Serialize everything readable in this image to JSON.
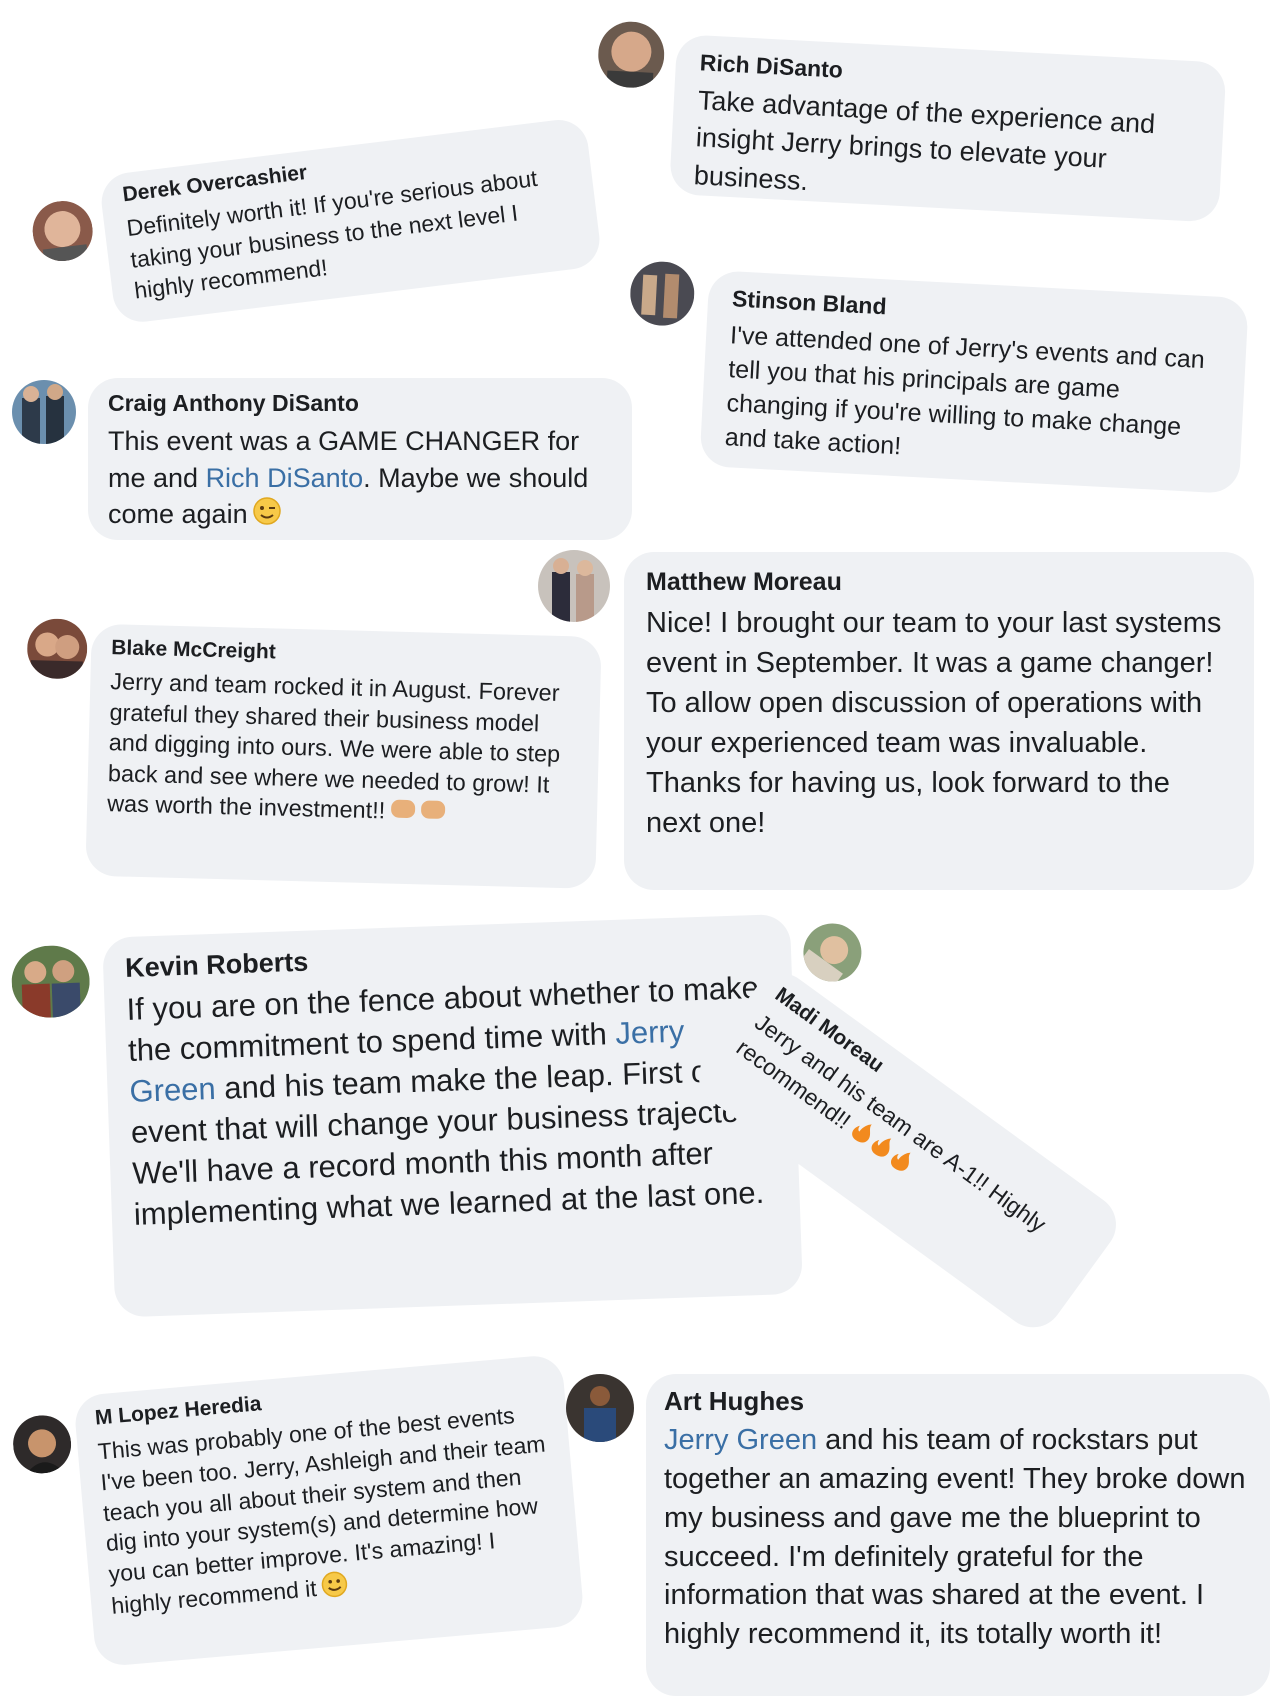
{
  "comments": {
    "rich": {
      "name": "Rich DiSanto",
      "text": "Take advantage of the experience and insight Jerry brings to elevate your business."
    },
    "derek": {
      "name": "Derek Overcashier",
      "text": "Definitely worth it! If you're serious about taking your business to the next level I highly recommend!"
    },
    "stinson": {
      "name": "Stinson Bland",
      "text": "I've attended one of Jerry's events and can tell you that his principals are game changing if you're willing to make change and take action!"
    },
    "craig": {
      "name": "Craig Anthony DiSanto",
      "text_before": "This event was a GAME CHANGER for me and ",
      "link": "Rich DiSanto",
      "text_after": ". Maybe we should come again",
      "emoji": "winking-face-emoji"
    },
    "matthew": {
      "name": "Matthew Moreau",
      "text": "Nice! I brought our team to your last systems event in September. It was a game changer! To allow open discussion of operations with your experienced team was invaluable. Thanks for having us, look forward to the next one!"
    },
    "blake": {
      "name": "Blake McCreight",
      "text": "Jerry and team rocked it in August. Forever grateful they shared their business model and digging into ours. We were able to step back and see where we needed to grow! It was worth the investment!!",
      "emoji": "fist-bump-emoji"
    },
    "kevin": {
      "name": "Kevin Roberts",
      "text_before": "If you are on the fence about whether to make the commitment to spend time with ",
      "link": "Jerry Green",
      "text_after": " and his team make the leap.  First class event that will change your business trajectory. We'll have a record month this month after implementing what we learned at the last one."
    },
    "madi": {
      "name": "Madi Moreau",
      "text": "Jerry and his team are A-1!! Highly recommend!!",
      "emoji": "fire-emoji"
    },
    "lopez": {
      "name": "M Lopez Heredia",
      "text": "This was probably one of the best events I've been too. Jerry, Ashleigh and their team teach you all about their system and then dig into your system(s) and determine how you can better improve. It's amazing! I highly recommend it",
      "emoji": "smiling-face-emoji"
    },
    "art": {
      "name": "Art Hughes",
      "link": "Jerry Green",
      "text_after": " and his team of rockstars put together an amazing event! They broke down my business and gave me the blueprint to succeed. I'm definitely grateful for the information that was shared at the event. I highly recommend it, its totally worth it!"
    }
  },
  "colors": {
    "bubble": "#eff1f4",
    "text": "#1c1e21",
    "link": "#3a6fa5"
  }
}
